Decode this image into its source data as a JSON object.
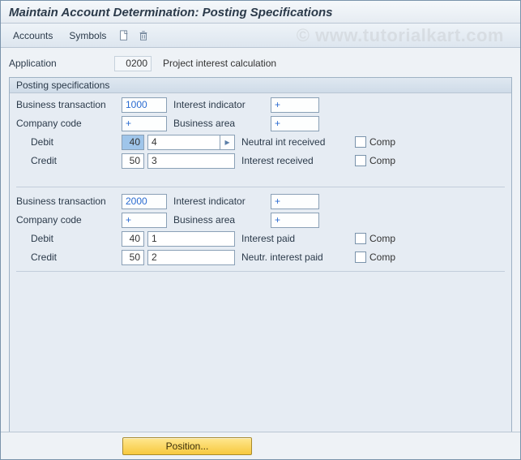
{
  "title": "Maintain Account Determination: Posting Specifications",
  "watermark": "© www.tutorialkart.com",
  "toolbar": {
    "accounts": "Accounts",
    "symbols": "Symbols"
  },
  "header": {
    "application_label": "Application",
    "application_value": "0200",
    "application_desc": "Project interest calculation"
  },
  "box": {
    "title": "Posting specifications",
    "labels": {
      "bus_trans": "Business transaction",
      "int_ind": "Interest indicator",
      "comp_code": "Company code",
      "bus_area": "Business area",
      "debit": "Debit",
      "credit": "Credit",
      "comp": "Comp"
    },
    "groups": [
      {
        "bus_trans": "1000",
        "int_ind": "+",
        "comp_code": "+",
        "bus_area": "+",
        "lines": [
          {
            "type": "Debit",
            "pk": "40",
            "sym": "4",
            "desc": "Neutral int received",
            "comp": false,
            "pk_selected": true
          },
          {
            "type": "Credit",
            "pk": "50",
            "sym": "3",
            "desc": "Interest received",
            "comp": false,
            "pk_selected": false
          }
        ]
      },
      {
        "bus_trans": "2000",
        "int_ind": "+",
        "comp_code": "+",
        "bus_area": "+",
        "lines": [
          {
            "type": "Debit",
            "pk": "40",
            "sym": "1",
            "desc": "Interest paid",
            "comp": false,
            "pk_selected": false
          },
          {
            "type": "Credit",
            "pk": "50",
            "sym": "2",
            "desc": "Neutr. interest paid",
            "comp": false,
            "pk_selected": false
          }
        ]
      }
    ]
  },
  "footer": {
    "position": "Position..."
  }
}
